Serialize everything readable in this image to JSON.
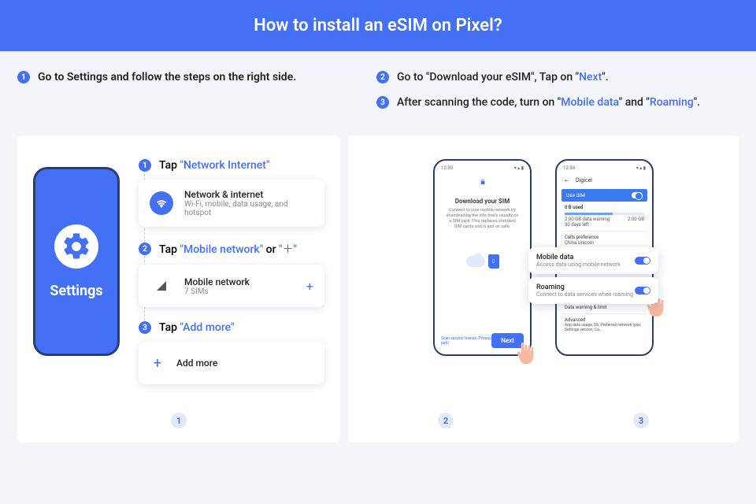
{
  "header": {
    "title": "How to install an eSIM on Pixel?"
  },
  "intro": {
    "left": {
      "num": "1",
      "text": "Go to Settings and follow the steps on the right side."
    },
    "right": [
      {
        "num": "2",
        "pre": "Go to \"Download your eSIM\", Tap on \"",
        "hl": "Next",
        "post": "\"."
      },
      {
        "num": "3",
        "pre": "After scanning the code, turn on \"",
        "hl1": "Mobile data",
        "mid": "\" and \"",
        "hl2": "Roaming",
        "post": "\"."
      }
    ]
  },
  "phone1": {
    "label": "Settings"
  },
  "steps": [
    {
      "num": "1",
      "label": "Tap ",
      "hl": "\"Network Internet\"",
      "card": {
        "title": "Network & internet",
        "sub": "Wi-Fi, mobile, data usage, and hotspot"
      }
    },
    {
      "num": "2",
      "label": "Tap ",
      "hl": "\"Mobile network\"",
      "label2": " or ",
      "hl2": "\"＋\"",
      "card": {
        "title": "Mobile network",
        "sub": "7 SIMs",
        "plus": "+"
      }
    },
    {
      "num": "3",
      "label": "Tap ",
      "hl": "\"Add more\"",
      "card": {
        "title": "Add more"
      }
    }
  ],
  "panel_badges": {
    "left": "1",
    "r1": "2",
    "r2": "3"
  },
  "screen2": {
    "time": "12:30",
    "title": "Download your SIM",
    "desc": "Connect to your mobile network by downloading the info that's usually on a SIM card. This replaces standard SIM cards and is just as safe.",
    "footer_link": "Scan service license, Privacy path",
    "next": "Next"
  },
  "screen3": {
    "time": "12:30",
    "carrier": "Digicel",
    "use_sim": "Use SIM",
    "used_label": "0 B used",
    "data_line1": "2.00 GB data warning",
    "data_line2": "30 days left",
    "data_right": "2.00 GB",
    "calls_pref": "Calls preference",
    "calls_val": "China Unicom",
    "mobile_data": {
      "title": "Mobile data",
      "sub": "Access data using mobile network"
    },
    "roaming": {
      "title": "Roaming",
      "sub": "Connect to data services when roaming"
    },
    "sec_warn": "Data warning & limit",
    "sec_adv": "Advanced",
    "sec_adv_sub": "App data usage, 5G, Preferred network type, Settings version, Ca..."
  }
}
